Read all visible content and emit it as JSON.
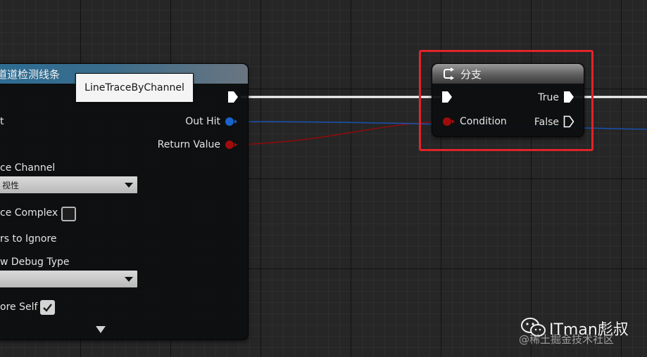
{
  "colors": {
    "exec_wire": "#ffffff",
    "hit_result_pin": "#1a63c9",
    "bool_pin": "#a00c0c",
    "highlight": "#e0242a",
    "left_header": "#2c6c93",
    "branch_header": "#7a7a7a"
  },
  "left_node": {
    "title": "道道检测线条",
    "tooltip": "LineTraceByChannel",
    "pins": {
      "out_hit": "Out Hit",
      "return_value": "Return Value",
      "partial_t": "t"
    },
    "trace_channel_label": "ce Channel",
    "trace_channel_value": "视性",
    "trace_complex_label": "ce Complex",
    "trace_complex_checked": false,
    "actors_to_ignore_label": "rs to Ignore",
    "draw_debug_type_label": "w Debug Type",
    "draw_debug_type_value": "",
    "ignore_self_label": "ore Self",
    "ignore_self_checked": true,
    "icons": {
      "exec_out": "exec-pin-icon",
      "out_hit": "struct-pin-icon",
      "return_value": "bool-pin-icon",
      "dropdown": "chevron-down-icon",
      "expand": "expand-arrow-icon"
    }
  },
  "branch_node": {
    "title": "分支",
    "icon": "branch-icon",
    "pins": {
      "true_label": "True",
      "false_label": "False",
      "condition_label": "Condition"
    }
  },
  "watermark": {
    "brand": "ITman彪叔",
    "sub": "@稀土掘金技术社区",
    "icon": "wechat-icon"
  }
}
